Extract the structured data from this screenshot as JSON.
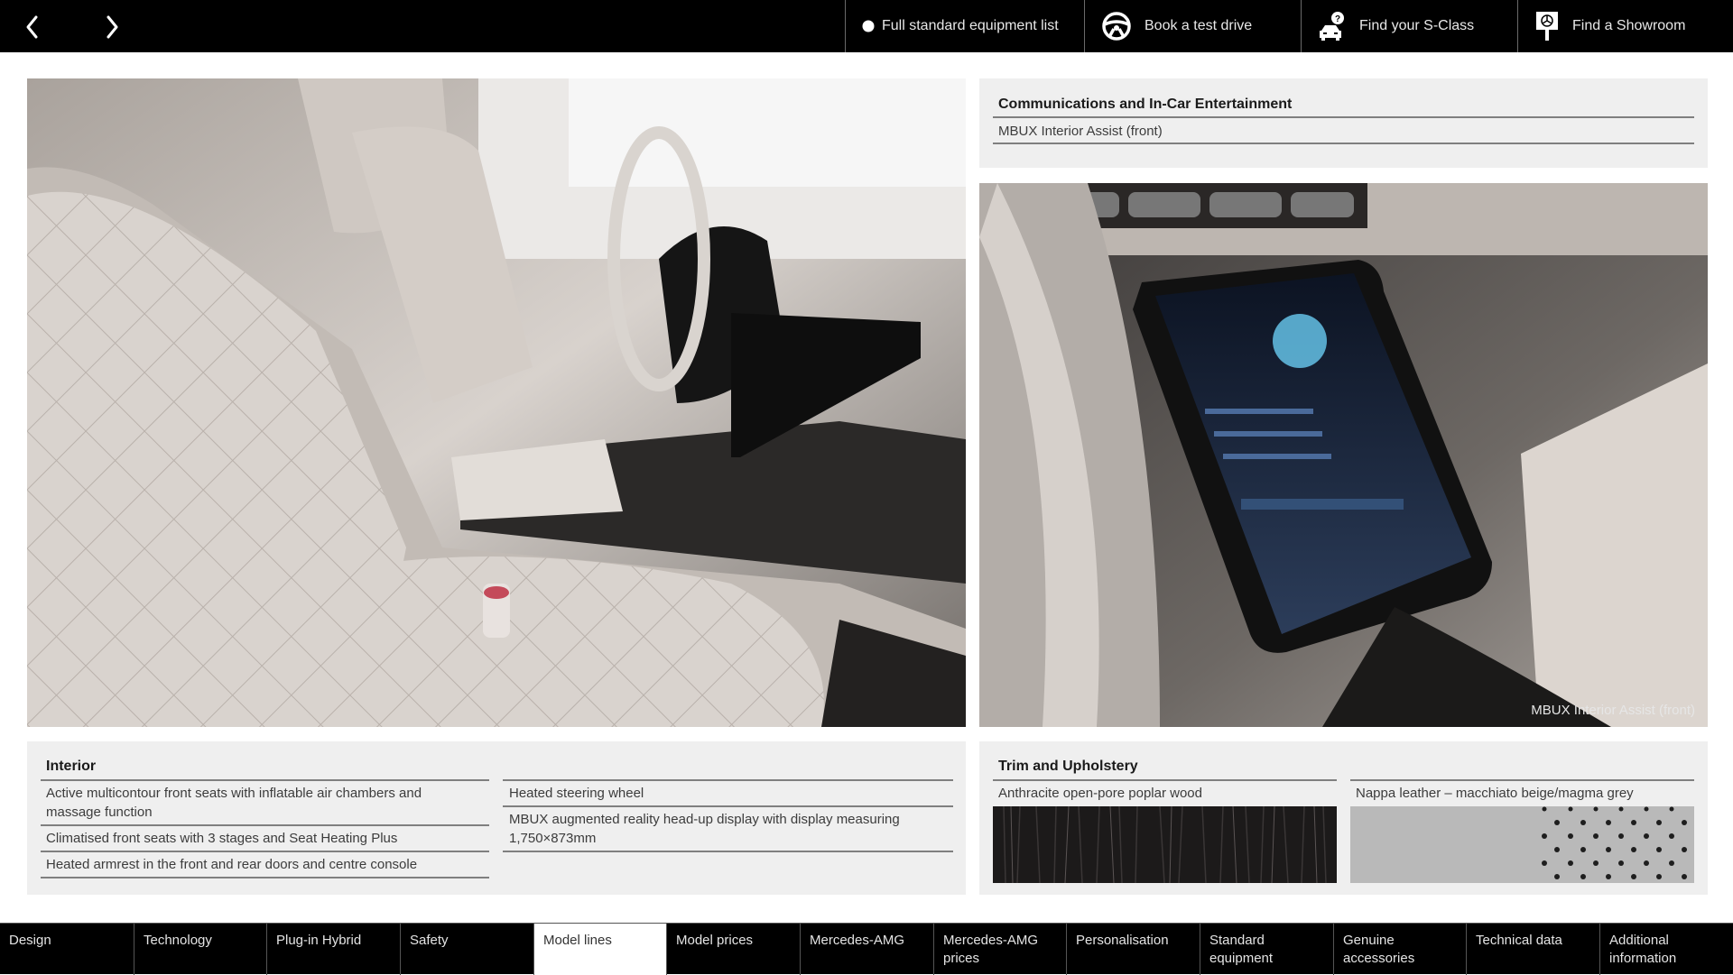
{
  "topbar": {
    "prev_icon": "chevron-left-icon",
    "next_icon": "chevron-right-icon",
    "links": [
      {
        "label": "Full standard equipment list",
        "icon": "filled-circle-icon"
      },
      {
        "label": "Book a test drive",
        "icon": "steering-wheel-icon"
      },
      {
        "label": "Find your S-Class",
        "icon": "car-question-icon"
      },
      {
        "label": "Find a Showroom",
        "icon": "showroom-sign-icon"
      }
    ]
  },
  "main": {
    "left_photo_alt": "Front seat interior with quilted leather upholstery",
    "right_photo_alt": "MBUX central touchscreen display",
    "right_photo_caption": "MBUX Interior Assist (front)",
    "comms": {
      "title": "Communications and In-Car Entertainment",
      "items": [
        "MBUX Interior Assist (front)"
      ]
    },
    "interior": {
      "title": "Interior",
      "col1": [
        "Active multicontour front seats with inflatable air chambers and massage function",
        "Climatised front seats with 3 stages and Seat Heating Plus",
        "Heated armrest in the front and rear doors and centre console"
      ],
      "col2": [
        "Heated steering wheel",
        "MBUX augmented reality head-up display with display measuring 1,750×873mm"
      ]
    },
    "trim": {
      "title": "Trim and Upholstery",
      "swatches": [
        {
          "label": "Anthracite open-pore poplar wood",
          "color": "#1c1a1a"
        },
        {
          "label": "Nappa leather – macchiato beige/magma grey",
          "color": "#b9b9b9"
        }
      ]
    }
  },
  "bottomnav": {
    "active_index": 4,
    "items": [
      {
        "label": "Design"
      },
      {
        "label": "Technology"
      },
      {
        "label": "Plug-in Hybrid"
      },
      {
        "label": "Safety"
      },
      {
        "label": "Model lines"
      },
      {
        "label": "Model prices"
      },
      {
        "label": "Mercedes-AMG"
      },
      {
        "label": "Mercedes-AMG prices"
      },
      {
        "label": "Personalisation"
      },
      {
        "label": "Standard equipment"
      },
      {
        "label": "Genuine accessories"
      },
      {
        "label": "Technical data"
      },
      {
        "label": "Additional information"
      }
    ]
  }
}
